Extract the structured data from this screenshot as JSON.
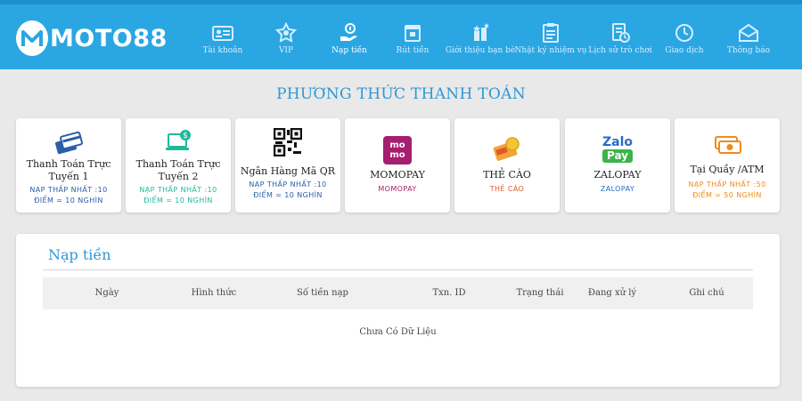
{
  "brand": {
    "logo_text": "MOTO88"
  },
  "nav": [
    {
      "label": "Tài khoản",
      "icon": "id-card-icon"
    },
    {
      "label": "VIP",
      "icon": "vip-badge-icon"
    },
    {
      "label": "Nạp tiền",
      "icon": "deposit-icon",
      "active": true
    },
    {
      "label": "Rút tiền",
      "icon": "withdraw-icon"
    },
    {
      "label": "Giới thiệu bạn bè",
      "icon": "refer-friend-icon"
    },
    {
      "label": "Nhật ký nhiệm vụ",
      "icon": "task-log-icon"
    },
    {
      "label": "Lịch sử trò chơi",
      "icon": "game-history-icon"
    },
    {
      "label": "Giao dịch",
      "icon": "transaction-icon"
    },
    {
      "label": "Thông báo",
      "icon": "notification-icon"
    }
  ],
  "payment_title": "PHƯƠNG THỨC THANH TOÁN",
  "payment_methods": [
    {
      "title": "Thanh Toán Trực Tuyến 1",
      "line1": "NẠP THẤP NHẤT :10",
      "line2": "ĐIỂM = 10 NGHÌN",
      "color": "#2a5ea8",
      "icon": "credit-cards-icon"
    },
    {
      "title": "Thanh Toán Trực Tuyến 2",
      "line1": "NẠP THẤP NHẤT :10",
      "line2": "ĐIỂM = 10 NGHÌN",
      "color": "#1fb99a",
      "icon": "laptop-money-icon"
    },
    {
      "title": "Ngân Hàng Mã QR",
      "line1": "NẠP THẤP NHẤT :10",
      "line2": "ĐIỂM = 10 NGHÌN",
      "color": "#2a5ea8",
      "icon": "qr-code-icon"
    },
    {
      "title": "MOMOPAY",
      "line1": "MOMOPAY",
      "line2": "",
      "color": "#a61e6e",
      "icon": "momo-logo-icon",
      "icon_text": "mo mo"
    },
    {
      "title": "THẺ CÀO",
      "line1": "THẺ CÀO",
      "line2": "",
      "color": "#e3562a",
      "icon": "scratch-card-icon"
    },
    {
      "title": "ZALOPAY",
      "line1": "ZALOPAY",
      "line2": "",
      "color": "#2a6cc4",
      "icon": "zalopay-logo-icon",
      "icon_text_top": "Zalo",
      "icon_text_bottom": "Pay"
    },
    {
      "title": "Tại Quầy /ATM",
      "line1": "NẠP THẤP NHẤT :50",
      "line2": "ĐIỂM = 50 NGHÌN",
      "color": "#f08a1c",
      "icon": "atm-cash-icon"
    }
  ],
  "deposit": {
    "title": "Nạp tiền",
    "columns": [
      "Ngày",
      "Hình thức",
      "Số tiền nạp",
      "Txn. ID",
      "Trạng thái",
      "Đang xử lý",
      "Ghi chú"
    ],
    "empty_text": "Chưa Có Dữ Liệu"
  }
}
